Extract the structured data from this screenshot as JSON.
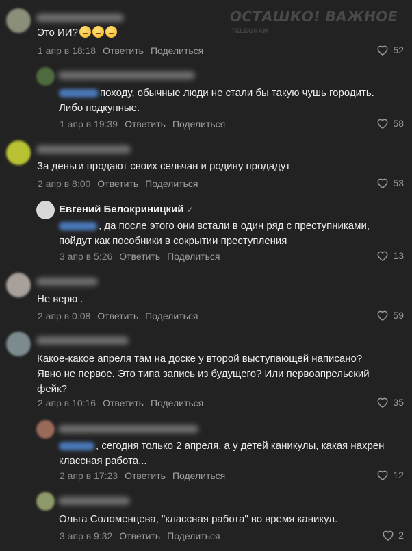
{
  "watermark": {
    "title": "ОСТАШКО! ВАЖНОЕ",
    "subtitle": "TELEGRAM"
  },
  "actions": {
    "reply": "Ответить",
    "share": "Поделиться"
  },
  "comments": [
    {
      "text": "Это ИИ?",
      "emoji_count": 3,
      "date": "1 апр в 18:18",
      "likes": "52",
      "avatar_color": "#8a8f7a"
    },
    {
      "text": "походу, обычные люди не стали бы такую чушь городить.\nЛибо подкупные.",
      "date": "1 апр в 19:39",
      "likes": "58",
      "avatar_color": "#4e6b3f"
    },
    {
      "text": "За деньги продают своих сельчан и родину продадут",
      "date": "2 апр в 8:00",
      "likes": "53",
      "avatar_color": "#b9c232"
    },
    {
      "name": "Евгений Белокриницкий",
      "verified": "✓",
      "text": ", да после этого они встали в один ряд с преступниками,\nпойдут как пособники в сокрытии преступления",
      "date": "3 апр в 5:26",
      "likes": "13",
      "avatar_color": "#d8d8d8"
    },
    {
      "text": "Не верю .",
      "date": "2 апр в 0:08",
      "likes": "59",
      "avatar_color": "#a8a09a"
    },
    {
      "text": "Какое-какое апреля там на доске у второй выступающей написано?\nЯвно не первое. Это типа запись из будущего? Или первоапрельский\nфейк?",
      "date": "2 апр в 10:16",
      "likes": "35",
      "avatar_color": "#7d8a8e"
    },
    {
      "text": ", сегодня только 2 апреля, а у детей каникулы, какая нахрен\nклассная работа...",
      "date": "2 апр в 17:23",
      "likes": "12",
      "avatar_color": "#9a6a5a"
    },
    {
      "text": "Ольга Соломенцева, \"классная работа\" во время каникул.",
      "date": "3 апр в 9:32",
      "likes": "2",
      "avatar_color": "#8f9a6a"
    }
  ]
}
